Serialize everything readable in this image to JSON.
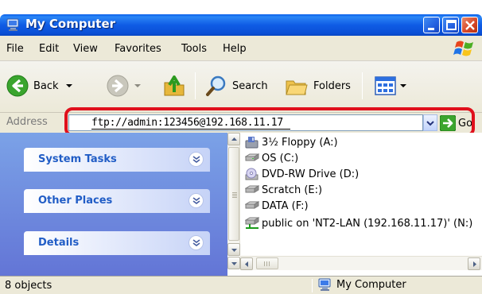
{
  "window": {
    "title": "My Computer",
    "icon": "computer-icon",
    "buttons": [
      "minimize",
      "maximize",
      "close"
    ]
  },
  "menu": {
    "items": [
      "File",
      "Edit",
      "View",
      "Favorites",
      "Tools",
      "Help"
    ]
  },
  "toolbar": {
    "back_label": "Back",
    "search_label": "Search",
    "folders_label": "Folders"
  },
  "address": {
    "label": "Address",
    "value": "ftp://admin:123456@192.168.11.17",
    "go_label": "Go"
  },
  "taskpane": {
    "sections": [
      {
        "title": "System Tasks"
      },
      {
        "title": "Other Places"
      },
      {
        "title": "Details"
      }
    ]
  },
  "drives": [
    {
      "label": "3½ Floppy (A:)",
      "icon": "floppy-icon"
    },
    {
      "label": "OS (C:)",
      "icon": "hard-drive-icon"
    },
    {
      "label": "DVD-RW Drive (D:)",
      "icon": "dvd-drive-icon"
    },
    {
      "label": "Scratch (E:)",
      "icon": "hard-drive-icon"
    },
    {
      "label": "DATA (F:)",
      "icon": "hard-drive-icon"
    },
    {
      "label": "public on 'NT2-LAN (192.168.11.17)' (N:)",
      "icon": "network-drive-icon"
    }
  ],
  "status": {
    "left": "8 objects",
    "right": "My Computer"
  },
  "colors": {
    "titlebar": "#0a5ee9",
    "highlight": "#e0101c",
    "taskpane": "#7ba2e7",
    "task_title": "#215dc6"
  }
}
